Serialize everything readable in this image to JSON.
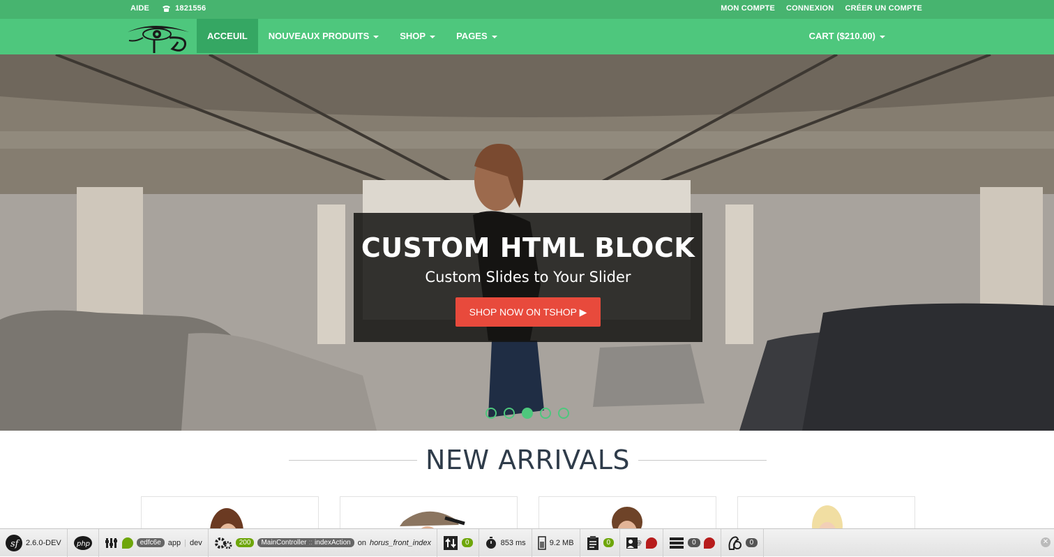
{
  "topbar": {
    "help": "AIDE",
    "phone": "1821556",
    "account": "MON COMPTE",
    "login": "CONNEXION",
    "register": "CRÉER UN COMPTE"
  },
  "nav": {
    "items": [
      {
        "label": "ACCEUIL",
        "active": true
      },
      {
        "label": "NOUVEAUX PRODUITS",
        "dropdown": true
      },
      {
        "label": "SHOP",
        "dropdown": true
      },
      {
        "label": "PAGES",
        "dropdown": true
      }
    ],
    "cart": "CART ($210.00)"
  },
  "hero": {
    "title": "CUSTOM HTML BLOCK",
    "subtitle": "Custom Slides to Your Slider",
    "cta": "SHOP NOW ON TSHOP ▶",
    "slide_count": 5,
    "active_slide": 3
  },
  "section": {
    "title": "NEW ARRIVALS"
  },
  "products": [
    {},
    {},
    {},
    {}
  ],
  "toolbar": {
    "version": "2.6.0-DEV",
    "php": "php",
    "token": "edfc6e",
    "app": "app",
    "env": "dev",
    "status": "200",
    "controller": "MainController",
    "sep": "::",
    "action": "indexAction",
    "on": "on",
    "route": "horus_front_index",
    "ajax": "0",
    "time": "853 ms",
    "memory": "9.2 MB",
    "logs": "0",
    "queries": "0",
    "twig": "0"
  },
  "colors": {
    "topbar": "#47b46f",
    "navbar": "#4ec77d",
    "active_nav": "#35a763",
    "cta": "#e84a3c"
  }
}
